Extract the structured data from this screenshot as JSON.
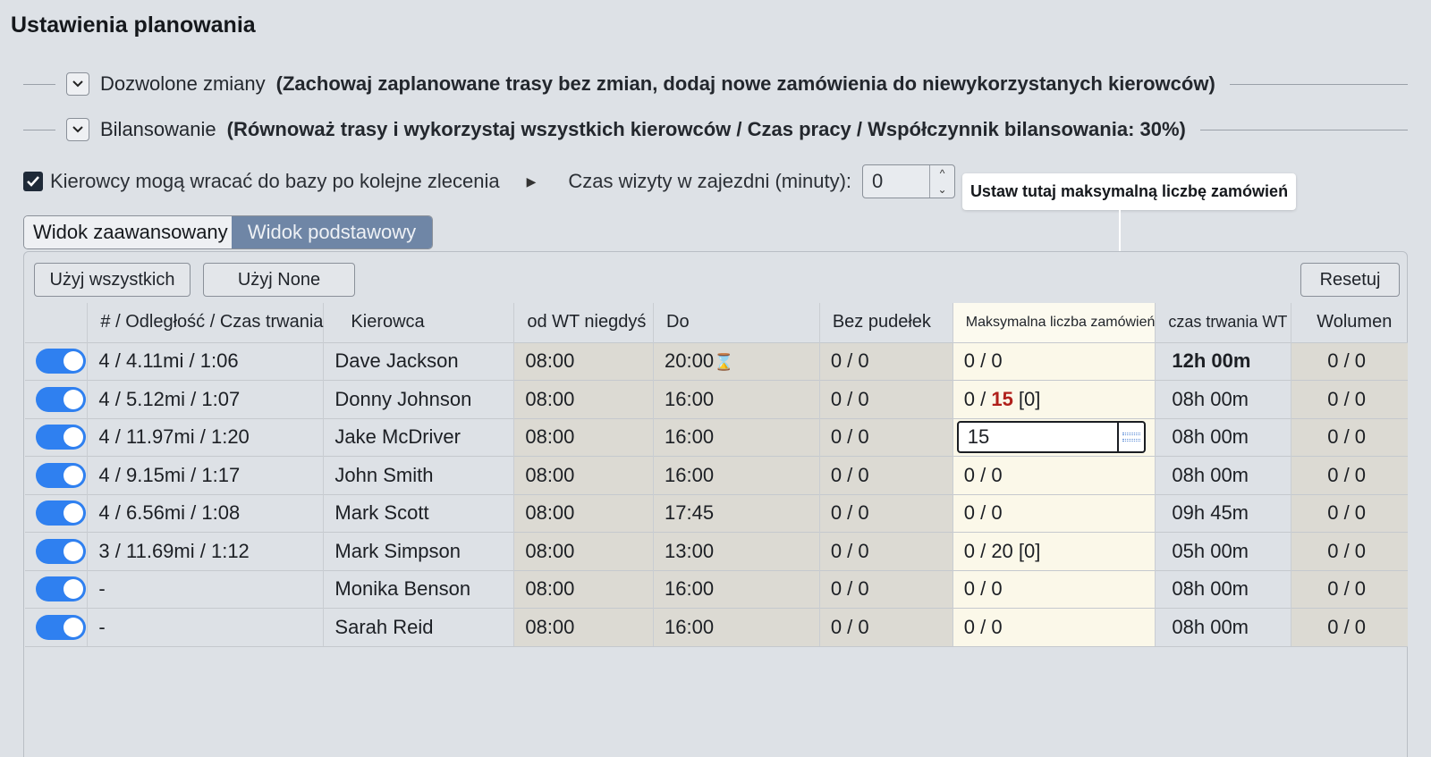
{
  "page": {
    "title": "Ustawienia planowania"
  },
  "sections": [
    {
      "label": "Dozwolone zmiany",
      "detail": "(Zachowaj zaplanowane trasy bez zmian, dodaj nowe zamówienia do niewykorzystanych kierowców)"
    },
    {
      "label": "Bilansowanie",
      "detail": "(Równoważ trasy i wykorzystaj wszystkich kierowców / Czas pracy / Współczynnik bilansowania: 30%)"
    }
  ],
  "options": {
    "return_to_base_label": "Kierowcy mogą wracać do bazy po kolejne zlecenia",
    "return_to_base_checked": true,
    "depot_visit_label": "Czas wizyty w zajezdni (minuty):",
    "depot_visit_value": "0"
  },
  "tooltip": {
    "text": "Ustaw tutaj maksymalną liczbę zamówień"
  },
  "view_tabs": {
    "advanced": "Widok zaawansowany",
    "basic": "Widok podstawowy",
    "active": "advanced"
  },
  "toolbar": {
    "use_all": "Użyj wszystkich",
    "use_none": "Użyj None",
    "reset": "Resetuj"
  },
  "table": {
    "headers": {
      "route": "# / Odległość / Czas trwania",
      "driver": "Kierowca",
      "from": "od WT niegdyś",
      "to": "Do",
      "no_boxes": "Bez pudełek",
      "max_orders": "Maksymalna liczba zamówień",
      "duration": "czas trwania WT",
      "volume": "Wolumen"
    },
    "rows": [
      {
        "enabled": true,
        "route": "4 / 4.11mi / 1:06",
        "driver": "Dave Jackson",
        "from": "08:00",
        "to": "20:00",
        "to_icon": "hourglass-icon",
        "no_boxes": "0 / 0",
        "max_prefix": "0 / 0",
        "max_limit": "",
        "max_suffix": "",
        "duration": "12h 00m",
        "duration_bold": true,
        "volume": "0 / 0"
      },
      {
        "enabled": true,
        "route": "4 / 5.12mi / 1:07",
        "driver": "Donny Johnson",
        "from": "08:00",
        "to": "16:00",
        "no_boxes": "0 / 0",
        "max_prefix": "0 / ",
        "max_limit": "15",
        "max_suffix": " [0]",
        "duration": "08h 00m",
        "volume": "0 / 0"
      },
      {
        "enabled": true,
        "route": "4 / 11.97mi / 1:20",
        "driver": "Jake McDriver",
        "from": "08:00",
        "to": "16:00",
        "no_boxes": "0 / 0",
        "max_input_value": "15",
        "duration": "08h 00m",
        "volume": "0 / 0"
      },
      {
        "enabled": true,
        "route": "4 / 9.15mi / 1:17",
        "driver": "John Smith",
        "from": "08:00",
        "to": "16:00",
        "no_boxes": "0 / 0",
        "max_prefix": "0 / 0",
        "max_limit": "",
        "max_suffix": "",
        "duration": "08h 00m",
        "volume": "0 / 0"
      },
      {
        "enabled": true,
        "route": "4 / 6.56mi / 1:08",
        "driver": "Mark Scott",
        "from": "08:00",
        "to": "17:45",
        "no_boxes": "0 / 0",
        "max_prefix": "0 / 0",
        "max_limit": "",
        "max_suffix": "",
        "duration": "09h 45m",
        "volume": "0 / 0"
      },
      {
        "enabled": true,
        "route": "3 / 11.69mi / 1:12",
        "driver": "Mark Simpson",
        "from": "08:00",
        "to": "13:00",
        "no_boxes": "0 / 0",
        "max_prefix": "0 / 20 [0]",
        "max_limit": "",
        "max_suffix": "",
        "duration": "05h 00m",
        "volume": "0 / 0"
      },
      {
        "enabled": true,
        "route": "-",
        "driver": "Monika Benson",
        "from": "08:00",
        "to": "16:00",
        "no_boxes": "0 / 0",
        "max_prefix": "0 / 0",
        "max_limit": "",
        "max_suffix": "",
        "duration": "08h 00m",
        "volume": "0 / 0"
      },
      {
        "enabled": true,
        "route": "-",
        "driver": "Sarah Reid",
        "from": "08:00",
        "to": "16:00",
        "no_boxes": "0 / 0",
        "max_prefix": "0 / 0",
        "max_limit": "",
        "max_suffix": "",
        "duration": "08h 00m",
        "volume": "0 / 0"
      }
    ]
  }
}
